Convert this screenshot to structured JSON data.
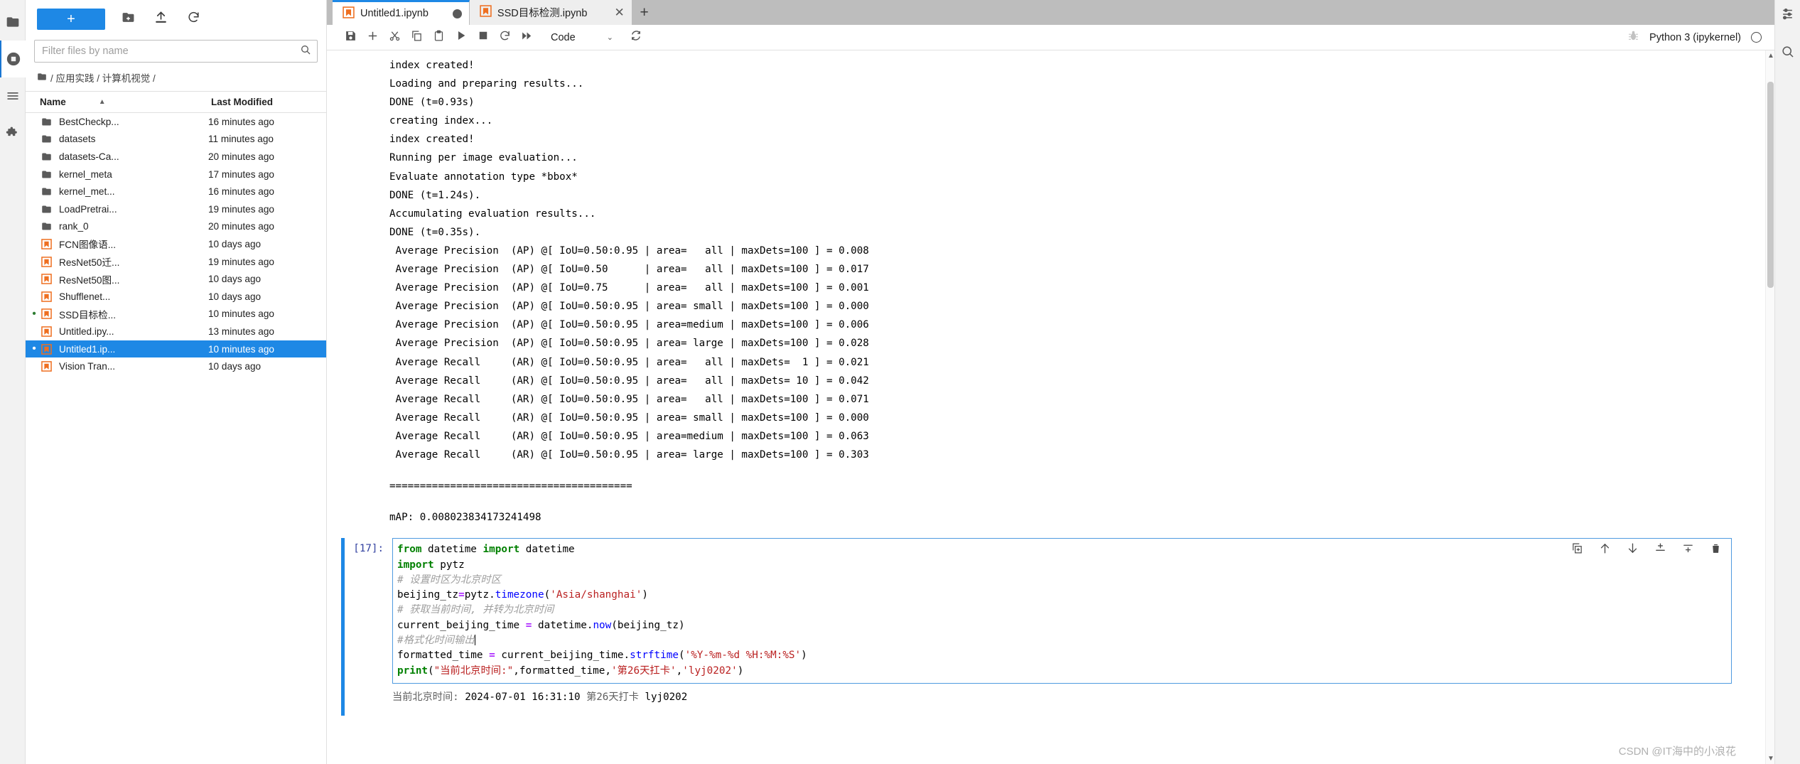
{
  "activity_bar": {
    "items": [
      {
        "name": "file-browser",
        "icon": "folder-icon",
        "active": false
      },
      {
        "name": "running-terminals",
        "icon": "stop-circle-icon",
        "active": true
      },
      {
        "name": "table-of-contents",
        "icon": "list-icon",
        "active": false
      },
      {
        "name": "extension-manager",
        "icon": "puzzle-icon",
        "active": false
      }
    ]
  },
  "file_browser": {
    "new_launcher_label": "+",
    "toolbar_buttons": [
      {
        "name": "new-folder-button",
        "icon": "new-folder-icon"
      },
      {
        "name": "upload-button",
        "icon": "upload-icon"
      },
      {
        "name": "refresh-button",
        "icon": "refresh-icon"
      }
    ],
    "filter": {
      "placeholder": "Filter files by name",
      "value": ""
    },
    "breadcrumb": {
      "home_icon": "folder-icon",
      "segments": [
        "应用实践",
        "计算机视觉"
      ],
      "text": "/ 应用实践 / 计算机视觉 /"
    },
    "columns": {
      "name": "Name",
      "last_modified": "Last Modified"
    },
    "sort_indicator": "▲",
    "items": [
      {
        "name": "BestCheckp...",
        "modified": "16 minutes ago",
        "type": "folder",
        "running": false,
        "selected": false
      },
      {
        "name": "datasets",
        "modified": "11 minutes ago",
        "type": "folder",
        "running": false,
        "selected": false
      },
      {
        "name": "datasets-Ca...",
        "modified": "20 minutes ago",
        "type": "folder",
        "running": false,
        "selected": false
      },
      {
        "name": "kernel_meta",
        "modified": "17 minutes ago",
        "type": "folder",
        "running": false,
        "selected": false
      },
      {
        "name": "kernel_met...",
        "modified": "16 minutes ago",
        "type": "folder",
        "running": false,
        "selected": false
      },
      {
        "name": "LoadPretrai...",
        "modified": "19 minutes ago",
        "type": "folder",
        "running": false,
        "selected": false
      },
      {
        "name": "rank_0",
        "modified": "20 minutes ago",
        "type": "folder",
        "running": false,
        "selected": false
      },
      {
        "name": "FCN图像语...",
        "modified": "10 days ago",
        "type": "notebook",
        "running": false,
        "selected": false
      },
      {
        "name": "ResNet50迁...",
        "modified": "19 minutes ago",
        "type": "notebook",
        "running": false,
        "selected": false
      },
      {
        "name": "ResNet50图...",
        "modified": "10 days ago",
        "type": "notebook",
        "running": false,
        "selected": false
      },
      {
        "name": "Shufflenet...",
        "modified": "10 days ago",
        "type": "notebook",
        "running": false,
        "selected": false
      },
      {
        "name": "SSD目标检...",
        "modified": "10 minutes ago",
        "type": "notebook",
        "running": true,
        "selected": false
      },
      {
        "name": "Untitled.ipy...",
        "modified": "13 minutes ago",
        "type": "notebook",
        "running": false,
        "selected": false
      },
      {
        "name": "Untitled1.ip...",
        "modified": "10 minutes ago",
        "type": "notebook",
        "running": true,
        "selected": true
      },
      {
        "name": "Vision Tran...",
        "modified": "10 days ago",
        "type": "notebook",
        "running": false,
        "selected": false
      }
    ]
  },
  "tabs": {
    "items": [
      {
        "label": "Untitled1.ipynb",
        "active": true,
        "dirty": true,
        "closable": false
      },
      {
        "label": "SSD目标检测.ipynb",
        "active": false,
        "dirty": false,
        "closable": true
      }
    ],
    "add_tab_label": "+"
  },
  "notebook_toolbar": {
    "buttons": [
      {
        "name": "save-button",
        "icon": "save-icon",
        "title": "Save"
      },
      {
        "name": "insert-cell-button",
        "icon": "plus-icon",
        "title": "Insert cell below"
      },
      {
        "name": "cut-cell-button",
        "icon": "scissors-icon",
        "title": "Cut"
      },
      {
        "name": "copy-cell-button",
        "icon": "copy-icon",
        "title": "Copy"
      },
      {
        "name": "paste-cell-button",
        "icon": "clipboard-icon",
        "title": "Paste"
      },
      {
        "name": "run-cell-button",
        "icon": "play-icon",
        "title": "Run"
      },
      {
        "name": "interrupt-kernel-button",
        "icon": "stop-square-icon",
        "title": "Interrupt"
      },
      {
        "name": "restart-kernel-button",
        "icon": "restart-icon",
        "title": "Restart"
      },
      {
        "name": "restart-run-all-button",
        "icon": "fast-forward-icon",
        "title": "Restart and run all"
      }
    ],
    "cell_type": "Code",
    "cell_type_caret": "⌄",
    "sync_icon": "sync-icon",
    "debug_icon": "bug-icon",
    "kernel_name": "Python 3 (ipykernel)",
    "kernel_status": "idle"
  },
  "notebook": {
    "scrolled_output_lines": [
      "index created!",
      "Loading and preparing results...",
      "DONE (t=0.93s)",
      "creating index...",
      "index created!",
      "Running per image evaluation...",
      "Evaluate annotation type *bbox*",
      "DONE (t=1.24s).",
      "Accumulating evaluation results...",
      "DONE (t=0.35s).",
      " Average Precision  (AP) @[ IoU=0.50:0.95 | area=   all | maxDets=100 ] = 0.008",
      " Average Precision  (AP) @[ IoU=0.50      | area=   all | maxDets=100 ] = 0.017",
      " Average Precision  (AP) @[ IoU=0.75      | area=   all | maxDets=100 ] = 0.001",
      " Average Precision  (AP) @[ IoU=0.50:0.95 | area= small | maxDets=100 ] = 0.000",
      " Average Precision  (AP) @[ IoU=0.50:0.95 | area=medium | maxDets=100 ] = 0.006",
      " Average Precision  (AP) @[ IoU=0.50:0.95 | area= large | maxDets=100 ] = 0.028",
      " Average Recall     (AR) @[ IoU=0.50:0.95 | area=   all | maxDets=  1 ] = 0.021",
      " Average Recall     (AR) @[ IoU=0.50:0.95 | area=   all | maxDets= 10 ] = 0.042",
      " Average Recall     (AR) @[ IoU=0.50:0.95 | area=   all | maxDets=100 ] = 0.071",
      " Average Recall     (AR) @[ IoU=0.50:0.95 | area= small | maxDets=100 ] = 0.000",
      " Average Recall     (AR) @[ IoU=0.50:0.95 | area=medium | maxDets=100 ] = 0.063",
      " Average Recall     (AR) @[ IoU=0.50:0.95 | area= large | maxDets=100 ] = 0.303"
    ],
    "separator_line": "========================================",
    "map_line": "mAP: 0.008023834173241498",
    "cell": {
      "prompt": "[17]:",
      "execution_count": 17,
      "lines": [
        "from datetime import datetime",
        "import pytz",
        "# 设置时区为北京时区",
        "beijing_tz=pytz.timezone('Asia/shanghai')",
        "# 获取当前时间, 并转为北京时间",
        "current_beijing_time = datetime.now(beijing_tz)",
        "#格式化时间输出",
        "formatted_time = current_beijing_time.strftime('%Y-%m-%d %H:%M:%S')",
        "print(\"当前北京时间:\",formatted_time,'第26天扛卡','lyj0202')"
      ],
      "toolbar": [
        {
          "name": "duplicate-cell-button",
          "icon": "duplicate-icon"
        },
        {
          "name": "move-cell-up-button",
          "icon": "arrow-up-icon"
        },
        {
          "name": "move-cell-down-button",
          "icon": "arrow-down-icon"
        },
        {
          "name": "insert-cell-above-button",
          "icon": "insert-above-icon"
        },
        {
          "name": "insert-cell-below-button",
          "icon": "insert-below-icon"
        },
        {
          "name": "delete-cell-button",
          "icon": "trash-icon"
        }
      ],
      "output": "当前北京时间: 2024-07-01 16:31:10 第26天打卡 lyj0202",
      "output_parts": {
        "label": "当前北京时间:",
        "timestamp": "2024-07-01 16:31:10",
        "streak": "第26天打卡",
        "user": "lyj0202"
      }
    }
  },
  "right_bar": {
    "items": [
      {
        "name": "settings-panel",
        "icon": "sliders-icon"
      },
      {
        "name": "property-inspector",
        "icon": "inspector-icon"
      }
    ]
  },
  "watermark": "CSDN @IT海中的小浪花",
  "colors": {
    "accent": "#1e88e5",
    "notebook_orange": "#ee6f21",
    "selected_row": "#1e88e5",
    "tabbar_bg": "#bdbdbd",
    "keyword_green": "#008000",
    "string_red": "#ba2121",
    "comment_gray": "#9e9e9e",
    "function_blue": "#0000ff",
    "operator_purple": "#aa22ff"
  }
}
